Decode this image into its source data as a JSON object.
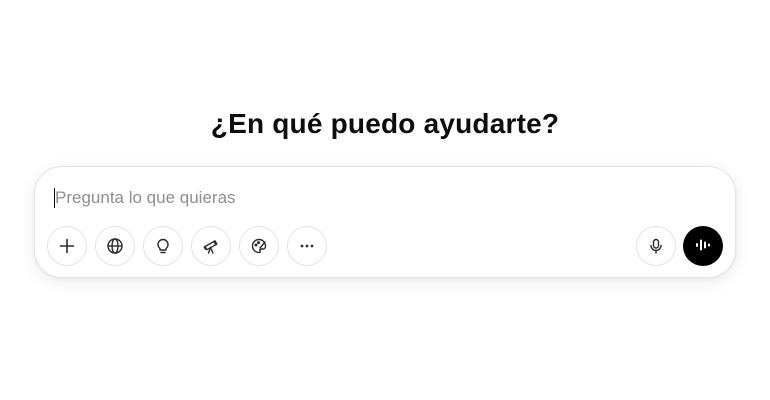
{
  "main": {
    "heading": "¿En qué puedo ayudarte?"
  },
  "composer": {
    "placeholder": "Pregunta lo que quieras",
    "value": "",
    "tools": [
      {
        "icon": "plus-icon"
      },
      {
        "icon": "globe-icon"
      },
      {
        "icon": "lightbulb-icon"
      },
      {
        "icon": "telescope-icon"
      },
      {
        "icon": "paint-palette-icon"
      },
      {
        "icon": "more-dots-icon"
      }
    ],
    "right_tools": [
      {
        "icon": "microphone-icon"
      },
      {
        "icon": "voice-waveform-icon"
      }
    ]
  }
}
